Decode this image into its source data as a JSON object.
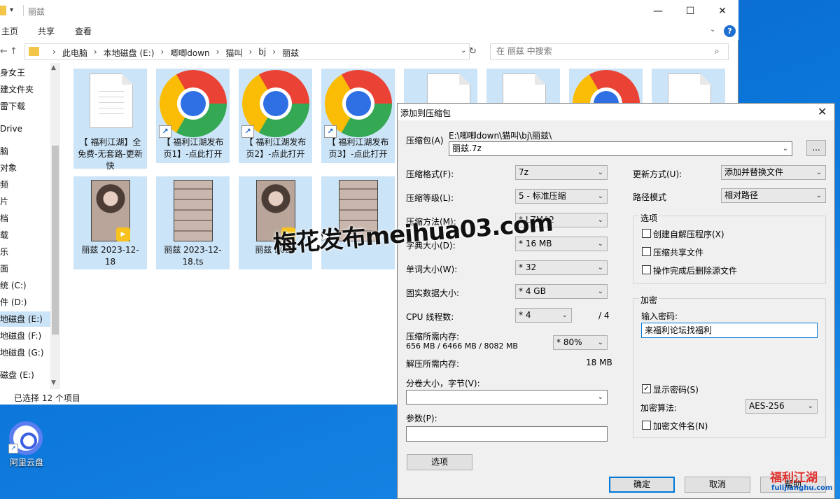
{
  "explorer": {
    "title": "丽兹",
    "ribbon_tabs": [
      "主页",
      "共享",
      "查看"
    ],
    "address": [
      "此电脑",
      "本地磁盘 (E:)",
      "唧唧down",
      "猫叫",
      "bj",
      "丽兹"
    ],
    "search_placeholder": "在 丽兹 中搜索",
    "nav_items": [
      "身女王",
      "建文件夹",
      "雷下载",
      "Drive",
      "脑",
      "对象",
      "频",
      "片",
      "档",
      "载",
      "乐",
      "面",
      "统 (C:)",
      "件 (D:)",
      "地磁盘 (E:)",
      "地磁盘 (F:)",
      "地磁盘 (G:)",
      "磁盘 (E:)"
    ],
    "files_row1": [
      {
        "label": "【 福利江湖】全免费-无套路-更新快",
        "type": "document"
      },
      {
        "label": "【 福利江湖发布页1】-点此打开",
        "type": "chrome-shortcut"
      },
      {
        "label": "【 福利江湖发布页2】-点此打开",
        "type": "chrome-shortcut"
      },
      {
        "label": "【 福利江湖发布页3】-点此打开",
        "type": "chrome-shortcut"
      }
    ],
    "files_row2": [
      {
        "label": "丽兹 2023-12-18",
        "type": "video"
      },
      {
        "label": "丽兹 2023-12-18.ts",
        "type": "video-grid"
      },
      {
        "label": "丽兹 2024",
        "type": "video"
      },
      {
        "label": "",
        "type": "video-grid"
      }
    ],
    "status": "已选择 12 个项目"
  },
  "desktop": {
    "icon_label": "阿里云盘"
  },
  "dialog": {
    "title": "添加到压缩包",
    "archive_label": "压缩包(A)",
    "archive_path": "E:\\唧唧down\\猫叫\\bj\\丽兹\\",
    "archive_name": "丽兹.7z",
    "browse_button": "...",
    "format_label": "压缩格式(F):",
    "format_value": "7z",
    "level_label": "压缩等级(L):",
    "level_value": "5 - 标准压缩",
    "method_label": "压缩方法(M):",
    "method_value": "* LZMA2",
    "dict_label": "字典大小(D):",
    "dict_value": "* 16 MB",
    "word_label": "单词大小(W):",
    "word_value": "* 32",
    "solid_label": "固实数据大小:",
    "solid_value": "* 4 GB",
    "cpu_label": "CPU 线程数:",
    "cpu_value": "* 4",
    "cpu_total": "/ 4",
    "mem_comp_label": "压缩所需内存:",
    "mem_comp_value": "656 MB / 6466 MB / 8082 MB",
    "mem_comp_pct": "* 80%",
    "mem_decomp_label": "解压所需内存:",
    "mem_decomp_value": "18 MB",
    "split_label": "分卷大小，字节(V):",
    "params_label": "参数(P):",
    "options_button": "选项",
    "update_label": "更新方式(U):",
    "update_value": "添加并替换文件",
    "path_label": "路径模式",
    "path_value": "相对路径",
    "options_group": "选项",
    "opt_sfx": "创建自解压程序(X)",
    "opt_shared": "压缩共享文件",
    "opt_delete": "操作完成后删除源文件",
    "encrypt_group": "加密",
    "password_label": "输入密码:",
    "password_value": "来福利论坛找福利",
    "show_password": "显示密码(S)",
    "algo_label": "加密算法:",
    "algo_value": "AES-256",
    "encrypt_names": "加密文件名(N)",
    "ok_button": "确定",
    "cancel_button": "取消",
    "help_button": "帮助"
  },
  "watermark": "梅花发布meihua03.com",
  "corner_logo": {
    "main": "福利江湖",
    "sub": "fulijianghu.com"
  }
}
